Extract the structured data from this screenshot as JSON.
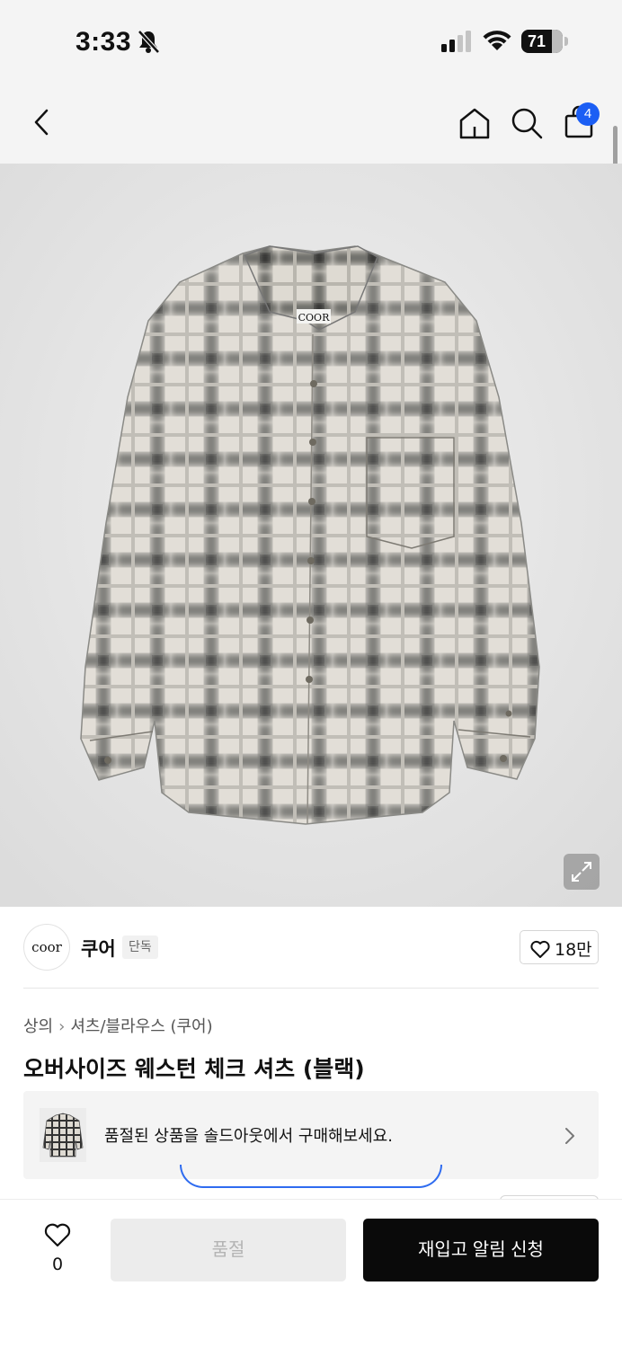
{
  "status_bar": {
    "time": "3:33",
    "battery": "71"
  },
  "nav": {
    "cart_count": "4"
  },
  "hero": {
    "collar_label": "COOR"
  },
  "brand": {
    "logo_text": "coor",
    "name": "쿠어",
    "tag": "단독",
    "likes": "18만"
  },
  "breadcrumb": {
    "category": "상의",
    "subcategory": "셔츠/블라우스 (쿠어)"
  },
  "product": {
    "title": "오버사이즈 웨스턴 체크 셔츠 (블랙)"
  },
  "soldout_banner": {
    "text": "품절된 상품을 솔드아웃에서 구매해보세요."
  },
  "bottom_bar": {
    "favorite_count": "0",
    "soldout_label": "품절",
    "restock_label": "재입고 알림 신청"
  }
}
